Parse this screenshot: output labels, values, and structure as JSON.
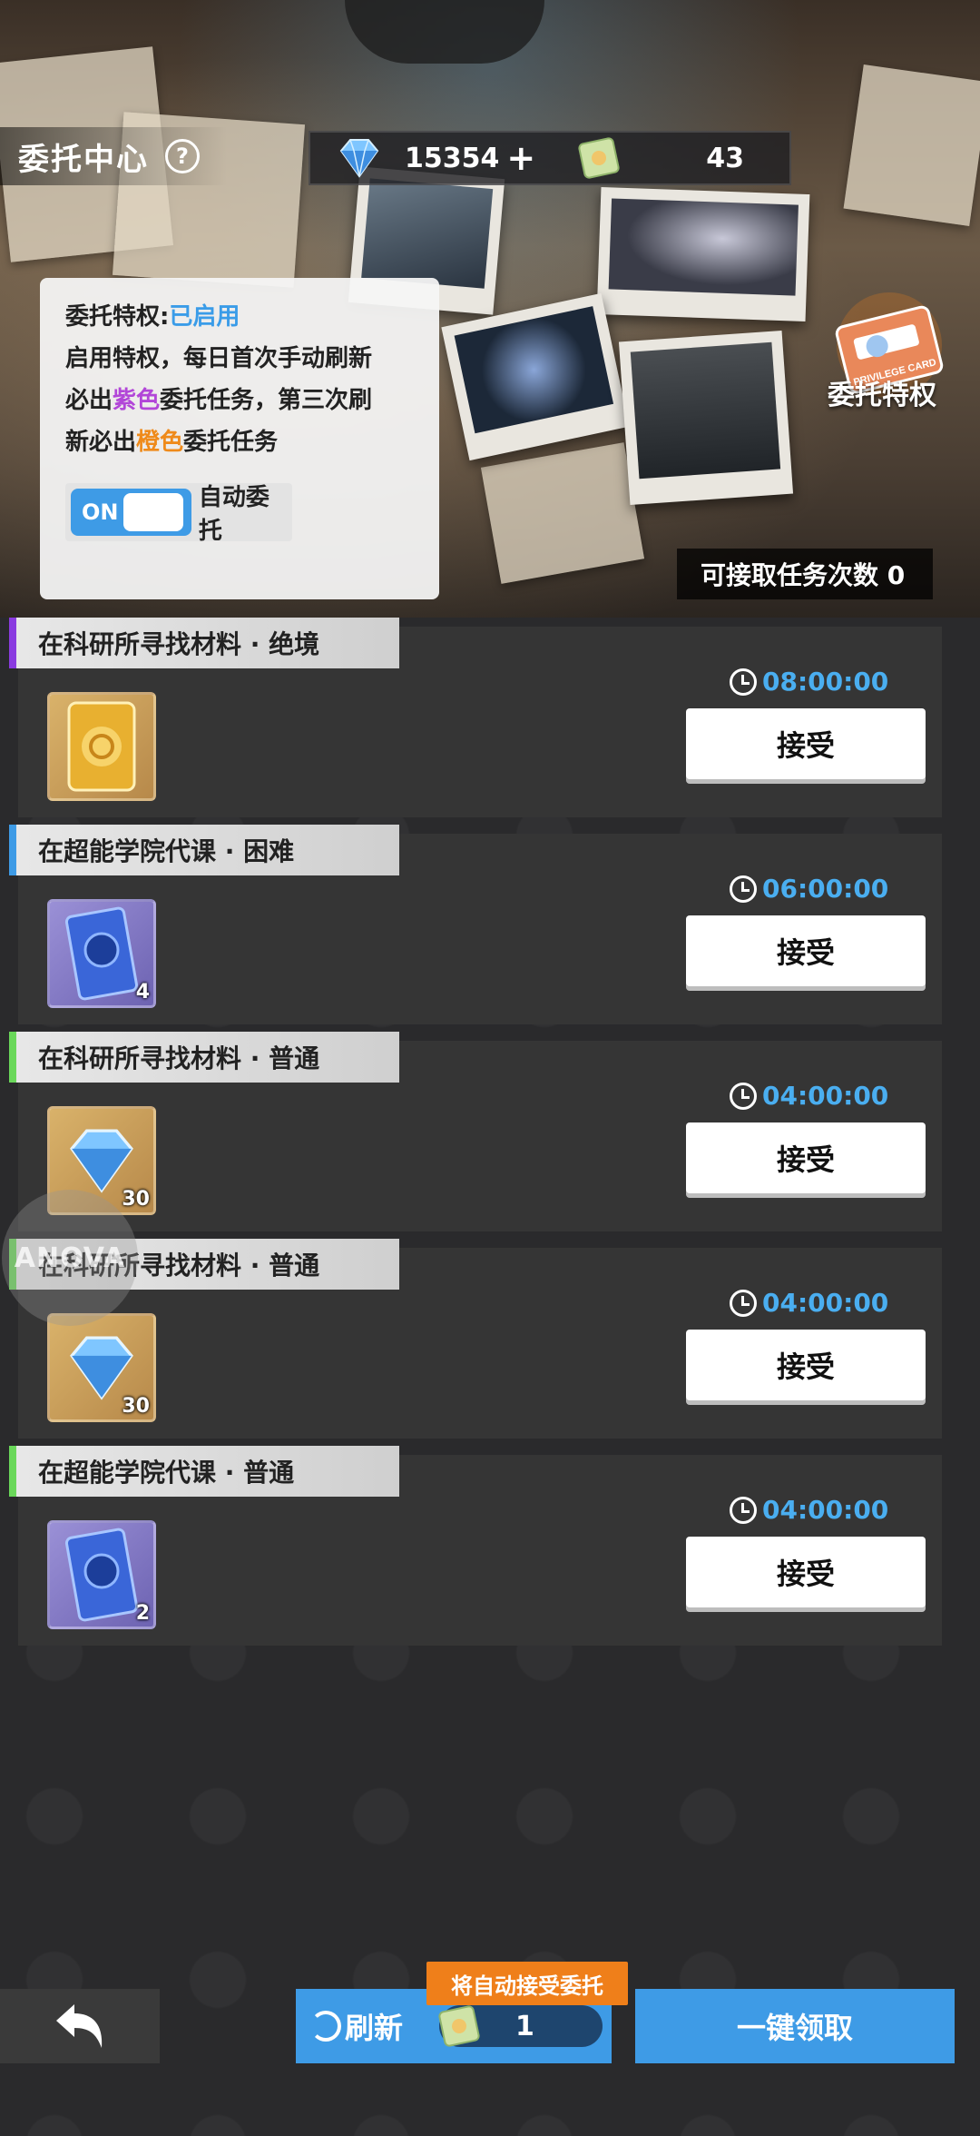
{
  "header": {
    "title": "委托中心",
    "help_icon": "?",
    "gems": "15354",
    "plus": "+",
    "tickets": "43"
  },
  "privilege": {
    "label": "委托特权:",
    "status": "已启用",
    "line2": "启用特权，每日首次手动刷新",
    "line3_prefix": "必出",
    "line3_purple": "紫色",
    "line3_suffix": "委托任务，第三次刷",
    "line4_prefix": "新必出",
    "line4_orange": "橙色",
    "line4_suffix": "委托任务",
    "toggle_state": "ON",
    "toggle_label": "自动委托",
    "card_label": "委托特权",
    "card_text": "PRIVILEGE CARD"
  },
  "accept_count": "可接取任务次数 0",
  "tasks": [
    {
      "title": "在科研所寻找材料 · 绝境",
      "stripe": "#8a3be0",
      "reward": "gold",
      "count": "",
      "time": "08:00:00",
      "button": "接受"
    },
    {
      "title": "在超能学院代课 · 困难",
      "stripe": "#3e9be6",
      "reward": "purple",
      "count": "4",
      "time": "06:00:00",
      "button": "接受"
    },
    {
      "title": "在科研所寻找材料 · 普通",
      "stripe": "#6ad85a",
      "reward": "gold",
      "count": "30",
      "time": "04:00:00",
      "button": "接受"
    },
    {
      "title": "在科研所寻找材料 · 普通",
      "stripe": "#6ad85a",
      "reward": "gold",
      "count": "30",
      "time": "04:00:00",
      "button": "接受"
    },
    {
      "title": "在超能学院代课 · 普通",
      "stripe": "#6ad85a",
      "reward": "purple",
      "count": "2",
      "time": "04:00:00",
      "button": "接受"
    }
  ],
  "watermark": "ANOVA",
  "bottom": {
    "refresh_label": "刷新",
    "auto_tag": "将自动接受委托",
    "refresh_cost": "1",
    "claim_label": "一键领取"
  },
  "colors": {
    "accent": "#3e9be6",
    "orange": "#ef7f1a",
    "timer": "#4aaef0"
  }
}
